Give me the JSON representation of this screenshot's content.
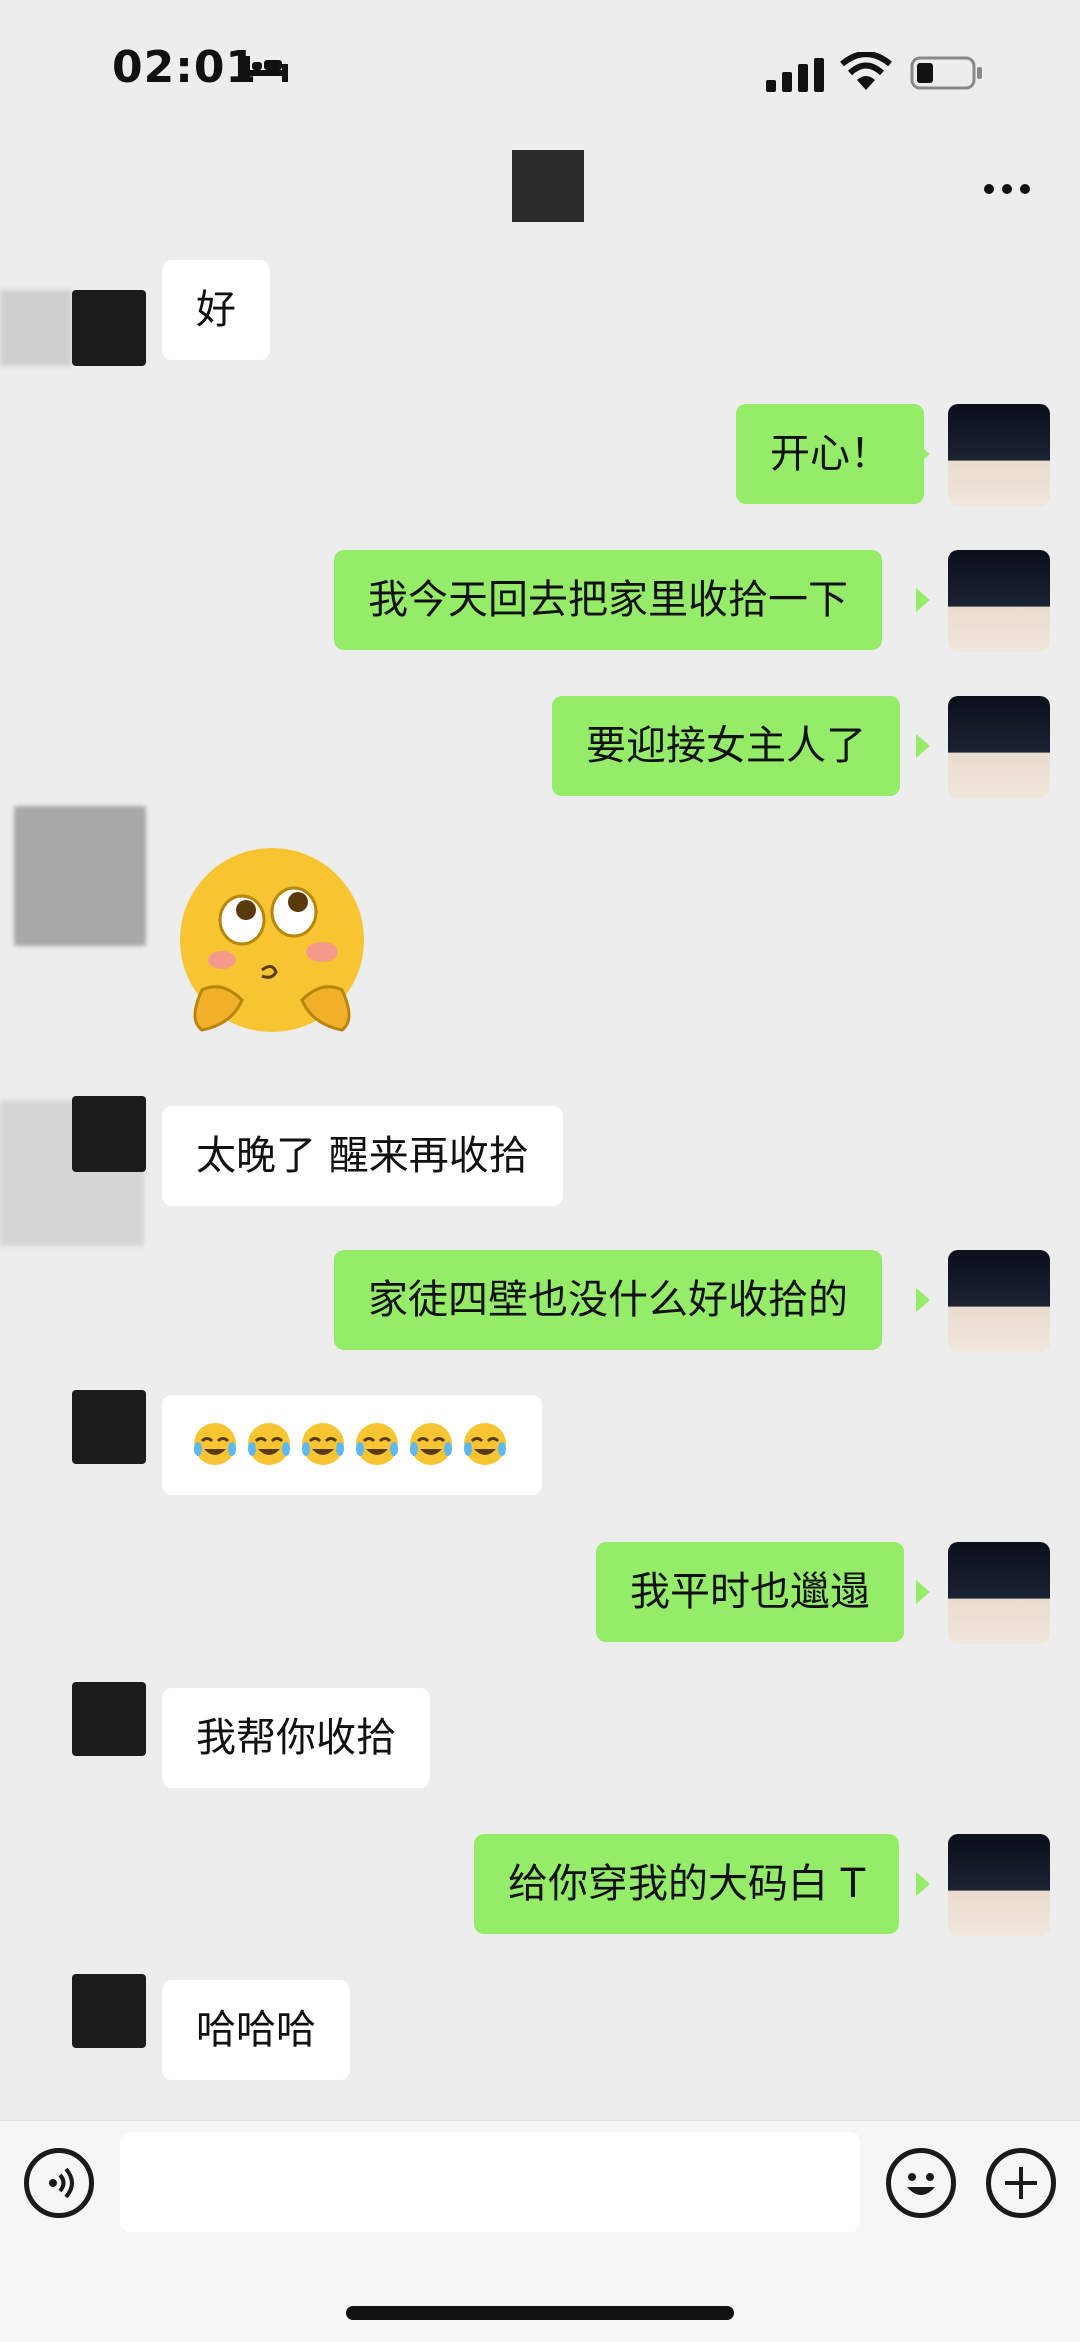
{
  "status_bar": {
    "time": "02:01"
  },
  "messages": [
    {
      "side": "other",
      "text": "好"
    },
    {
      "side": "me",
      "text": "开心！"
    },
    {
      "side": "me",
      "text": "我今天回去把家里收拾一下"
    },
    {
      "side": "me",
      "text": "要迎接女主人了"
    },
    {
      "side": "other",
      "type": "sticker",
      "icon": "blushing-emoji-sticker"
    },
    {
      "side": "other",
      "text": "太晚了 醒来再收拾"
    },
    {
      "side": "me",
      "text": "家徒四壁也没什么好收拾的"
    },
    {
      "side": "other",
      "type": "emoji",
      "icon": "crying-laughing-emoji",
      "count": 6
    },
    {
      "side": "me",
      "text": "我平时也邋遢"
    },
    {
      "side": "other",
      "text": "我帮你收拾"
    },
    {
      "side": "me",
      "text": "给你穿我的大码白 T"
    },
    {
      "side": "other",
      "text": "哈哈哈"
    }
  ],
  "colors": {
    "bubble_me": "#95ec69",
    "bubble_other": "#ffffff",
    "background": "#ededed"
  }
}
